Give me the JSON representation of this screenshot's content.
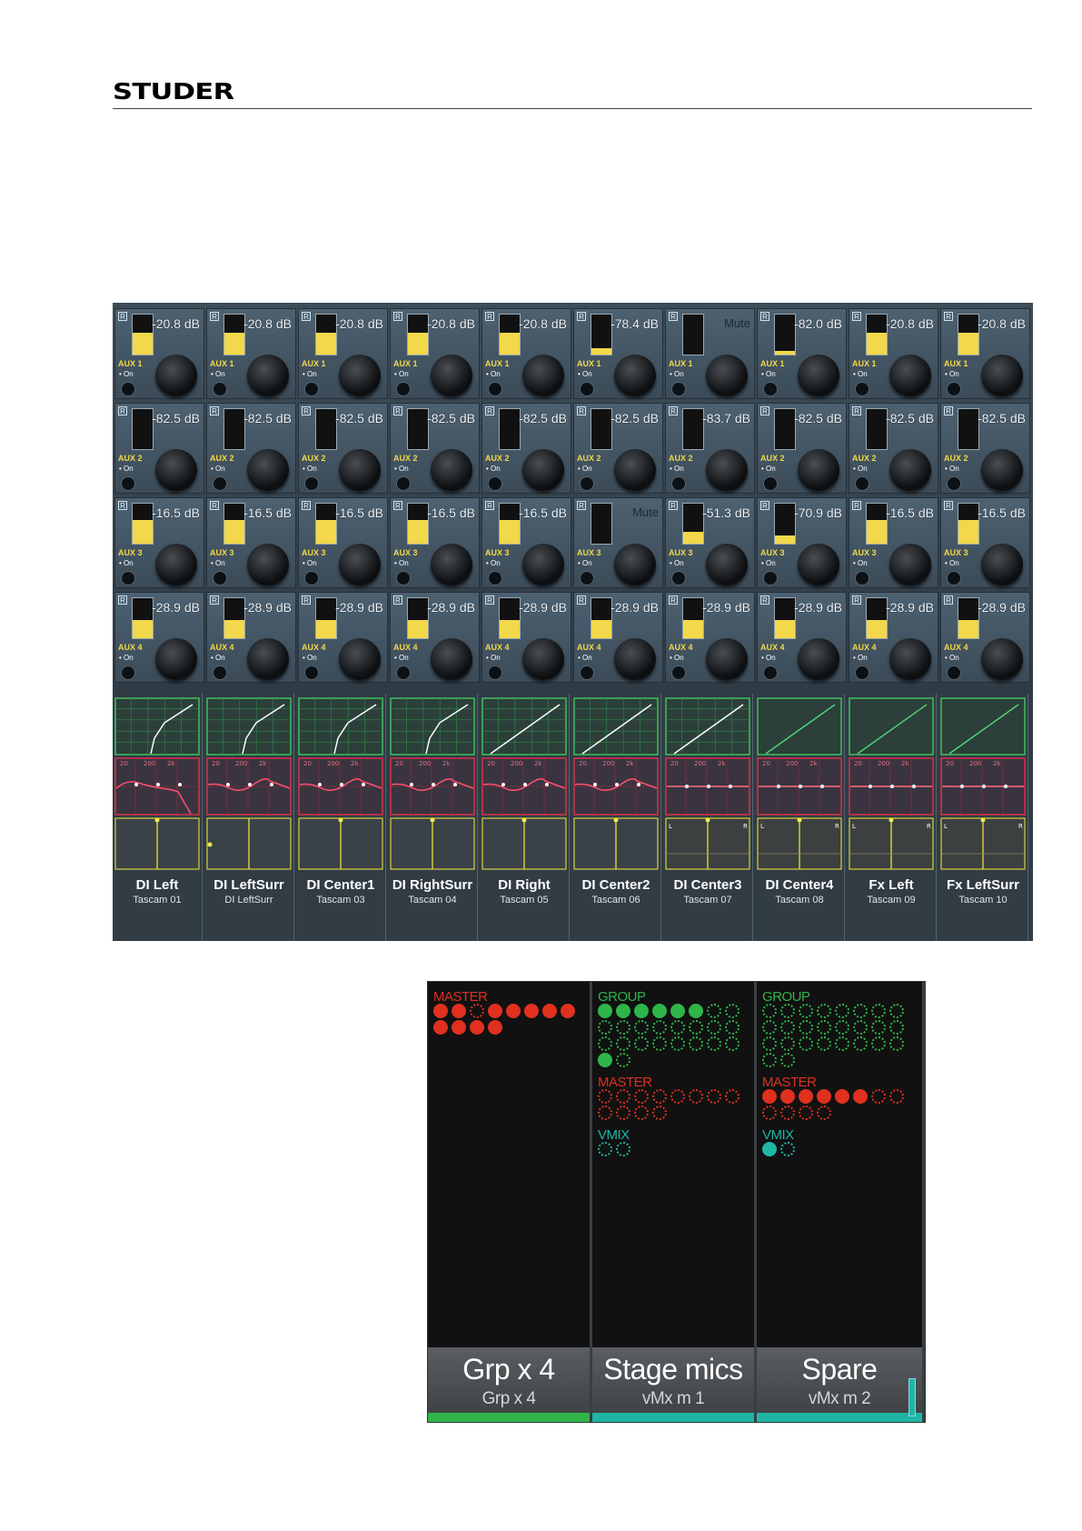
{
  "header": {
    "logo": "STUDER"
  },
  "aux_grid": {
    "rows": [
      {
        "label": "AUX 1",
        "on_label": "• On",
        "values": [
          "-20.8",
          "-20.8",
          "-20.8",
          "-20.8",
          "-20.8",
          "-78.4",
          "Mute",
          "-82.0",
          "-20.8",
          "-20.8"
        ],
        "units": [
          "dB",
          "dB",
          "dB",
          "dB",
          "dB",
          "dB",
          "",
          "dB",
          "dB",
          "dB"
        ],
        "levels": [
          0.55,
          0.55,
          0.55,
          0.55,
          0.55,
          0.15,
          0.0,
          0.1,
          0.55,
          0.55
        ]
      },
      {
        "label": "AUX 2",
        "on_label": "• On",
        "values": [
          "-82.5",
          "-82.5",
          "-82.5",
          "-82.5",
          "-82.5",
          "-82.5",
          "-83.7",
          "-82.5",
          "-82.5",
          "-82.5"
        ],
        "units": [
          "dB",
          "dB",
          "dB",
          "dB",
          "dB",
          "dB",
          "dB",
          "dB",
          "dB",
          "dB"
        ],
        "levels": [
          0,
          0,
          0,
          0,
          0,
          0,
          0,
          0,
          0,
          0
        ]
      },
      {
        "label": "AUX 3",
        "on_label": "• On",
        "values": [
          "-16.5",
          "-16.5",
          "-16.5",
          "-16.5",
          "-16.5",
          "Mute",
          "-51.3",
          "-70.9",
          "-16.5",
          "-16.5"
        ],
        "units": [
          "dB",
          "dB",
          "dB",
          "dB",
          "dB",
          "",
          "dB",
          "dB",
          "dB",
          "dB"
        ],
        "levels": [
          0.6,
          0.6,
          0.6,
          0.6,
          0.6,
          0.0,
          0.3,
          0.2,
          0.6,
          0.6
        ]
      },
      {
        "label": "AUX 4",
        "on_label": "• On",
        "values": [
          "-28.9",
          "-28.9",
          "-28.9",
          "-28.9",
          "-28.9",
          "-28.9",
          "-28.9",
          "-28.9",
          "-28.9",
          "-28.9"
        ],
        "units": [
          "dB",
          "dB",
          "dB",
          "dB",
          "dB",
          "dB",
          "dB",
          "dB",
          "dB",
          "dB"
        ],
        "levels": [
          0.45,
          0.45,
          0.45,
          0.45,
          0.45,
          0.45,
          0.45,
          0.45,
          0.45,
          0.45
        ]
      }
    ],
    "r_label": "R"
  },
  "channels": [
    {
      "name": "DI Left",
      "source": "Tascam 01"
    },
    {
      "name": "DI LeftSurr",
      "source": "DI LeftSurr"
    },
    {
      "name": "DI Center1",
      "source": "Tascam 03"
    },
    {
      "name": "DI RightSurr",
      "source": "Tascam 04"
    },
    {
      "name": "DI Right",
      "source": "Tascam 05"
    },
    {
      "name": "DI Center2",
      "source": "Tascam 06"
    },
    {
      "name": "DI Center3",
      "source": "Tascam 07"
    },
    {
      "name": "DI Center4",
      "source": "Tascam 08"
    },
    {
      "name": "Fx Left",
      "source": "Tascam 09"
    },
    {
      "name": "Fx LeftSurr",
      "source": "Tascam 10"
    }
  ],
  "eq_labels": [
    "20",
    "200",
    "2k"
  ],
  "pan_labels": {
    "left": "L",
    "right": "R"
  },
  "mix_panel": {
    "colors": {
      "group": "#2fb54a",
      "master": "#e0301e",
      "vmix": "#1fb5a5"
    },
    "columns": [
      {
        "title": "Grp x  4",
        "subtitle": "Grp x  4",
        "bar_color": "#2fb54a",
        "sections": [
          {
            "label": "MASTER",
            "kind": "master",
            "count": 12,
            "filled": [
              1,
              1,
              0,
              1,
              1,
              1,
              1,
              1,
              1,
              1,
              1,
              1
            ]
          }
        ]
      },
      {
        "title": "Stage mics",
        "subtitle": "vMx m  1",
        "bar_color": "#1fb5a5",
        "sections": [
          {
            "label": "GROUP",
            "kind": "group",
            "count": 26,
            "filled": [
              1,
              1,
              1,
              1,
              1,
              1,
              0,
              0,
              0,
              0,
              0,
              0,
              0,
              0,
              0,
              0,
              0,
              0,
              0,
              0,
              0,
              0,
              0,
              0,
              1,
              0
            ]
          },
          {
            "label": "MASTER",
            "kind": "master",
            "count": 12,
            "filled": [
              0,
              0,
              0,
              0,
              0,
              0,
              0,
              0,
              0,
              0,
              0,
              0
            ]
          },
          {
            "label": "VMIX",
            "kind": "vmix",
            "count": 2,
            "filled": [
              0,
              0
            ]
          }
        ]
      },
      {
        "title": "Spare",
        "subtitle": "vMx m  2",
        "bar_color": "#1fb5a5",
        "sections": [
          {
            "label": "GROUP",
            "kind": "group",
            "count": 26,
            "filled": [
              0,
              0,
              0,
              0,
              0,
              0,
              0,
              0,
              0,
              0,
              0,
              0,
              0,
              0,
              0,
              0,
              0,
              0,
              0,
              0,
              0,
              0,
              0,
              0,
              0,
              0
            ]
          },
          {
            "label": "MASTER",
            "kind": "master",
            "count": 12,
            "filled": [
              1,
              1,
              1,
              1,
              1,
              1,
              0,
              0,
              0,
              0,
              0,
              0
            ]
          },
          {
            "label": "VMIX",
            "kind": "vmix",
            "count": 2,
            "filled": [
              1,
              0
            ]
          }
        ]
      }
    ]
  }
}
